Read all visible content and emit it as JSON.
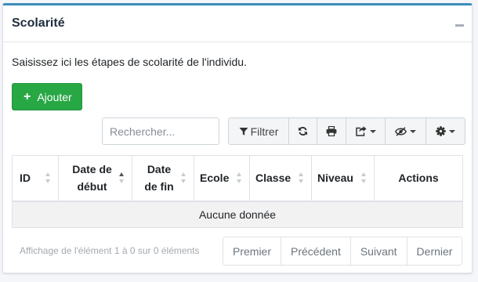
{
  "card": {
    "title": "Scolarité",
    "intro": "Saisissez ici les étapes de scolarité de l'individu."
  },
  "actions": {
    "add_label": "Ajouter"
  },
  "search": {
    "placeholder": "Rechercher..."
  },
  "toolbar": {
    "filter_label": "Filtrer",
    "icons": [
      "filter-icon",
      "refresh-icon",
      "print-icon",
      "export-icon",
      "eye-slash-icon",
      "gear-icon"
    ]
  },
  "table": {
    "columns": [
      {
        "label": "ID"
      },
      {
        "label": "Date de début"
      },
      {
        "label": "Date de fin"
      },
      {
        "label": "Ecole"
      },
      {
        "label": "Classe"
      },
      {
        "label": "Niveau"
      },
      {
        "label": "Actions"
      }
    ],
    "empty_text": "Aucune donnée"
  },
  "pagination": {
    "info": "Affichage de l'élément 1 à 0 sur 0 éléments",
    "first": "Premier",
    "previous": "Précédent",
    "next": "Suivant",
    "last": "Dernier"
  },
  "colors": {
    "accent": "#3c8dbc",
    "add_button": "#28a745"
  }
}
